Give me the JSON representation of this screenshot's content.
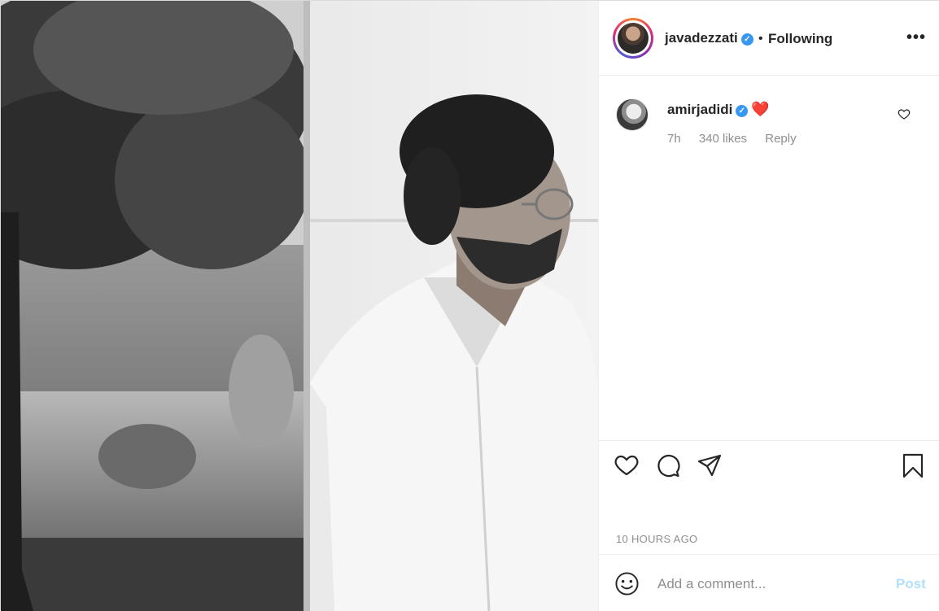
{
  "post": {
    "author": {
      "username": "javadezzati",
      "verified": true,
      "follow_status": "Following",
      "separator": "•"
    },
    "more_icon": "more-options-icon",
    "photo": {
      "description_icon": "post-photo"
    },
    "comments": [
      {
        "username": "amirjadidi",
        "verified": true,
        "text": "❤️",
        "time": "7h",
        "likes": "340 likes",
        "reply_label": "Reply"
      }
    ],
    "actions": {
      "like_icon": "heart-icon",
      "comment_icon": "comment-icon",
      "share_icon": "share-icon",
      "save_icon": "bookmark-icon"
    },
    "timestamp": "10 HOURS AGO",
    "add_comment": {
      "placeholder": "Add a comment...",
      "post_label": "Post"
    },
    "colors": {
      "link_disabled": "#b2dffc",
      "verified": "#3897f0",
      "muted_text": "#8e8e8e",
      "heart": "#e0192d"
    }
  }
}
